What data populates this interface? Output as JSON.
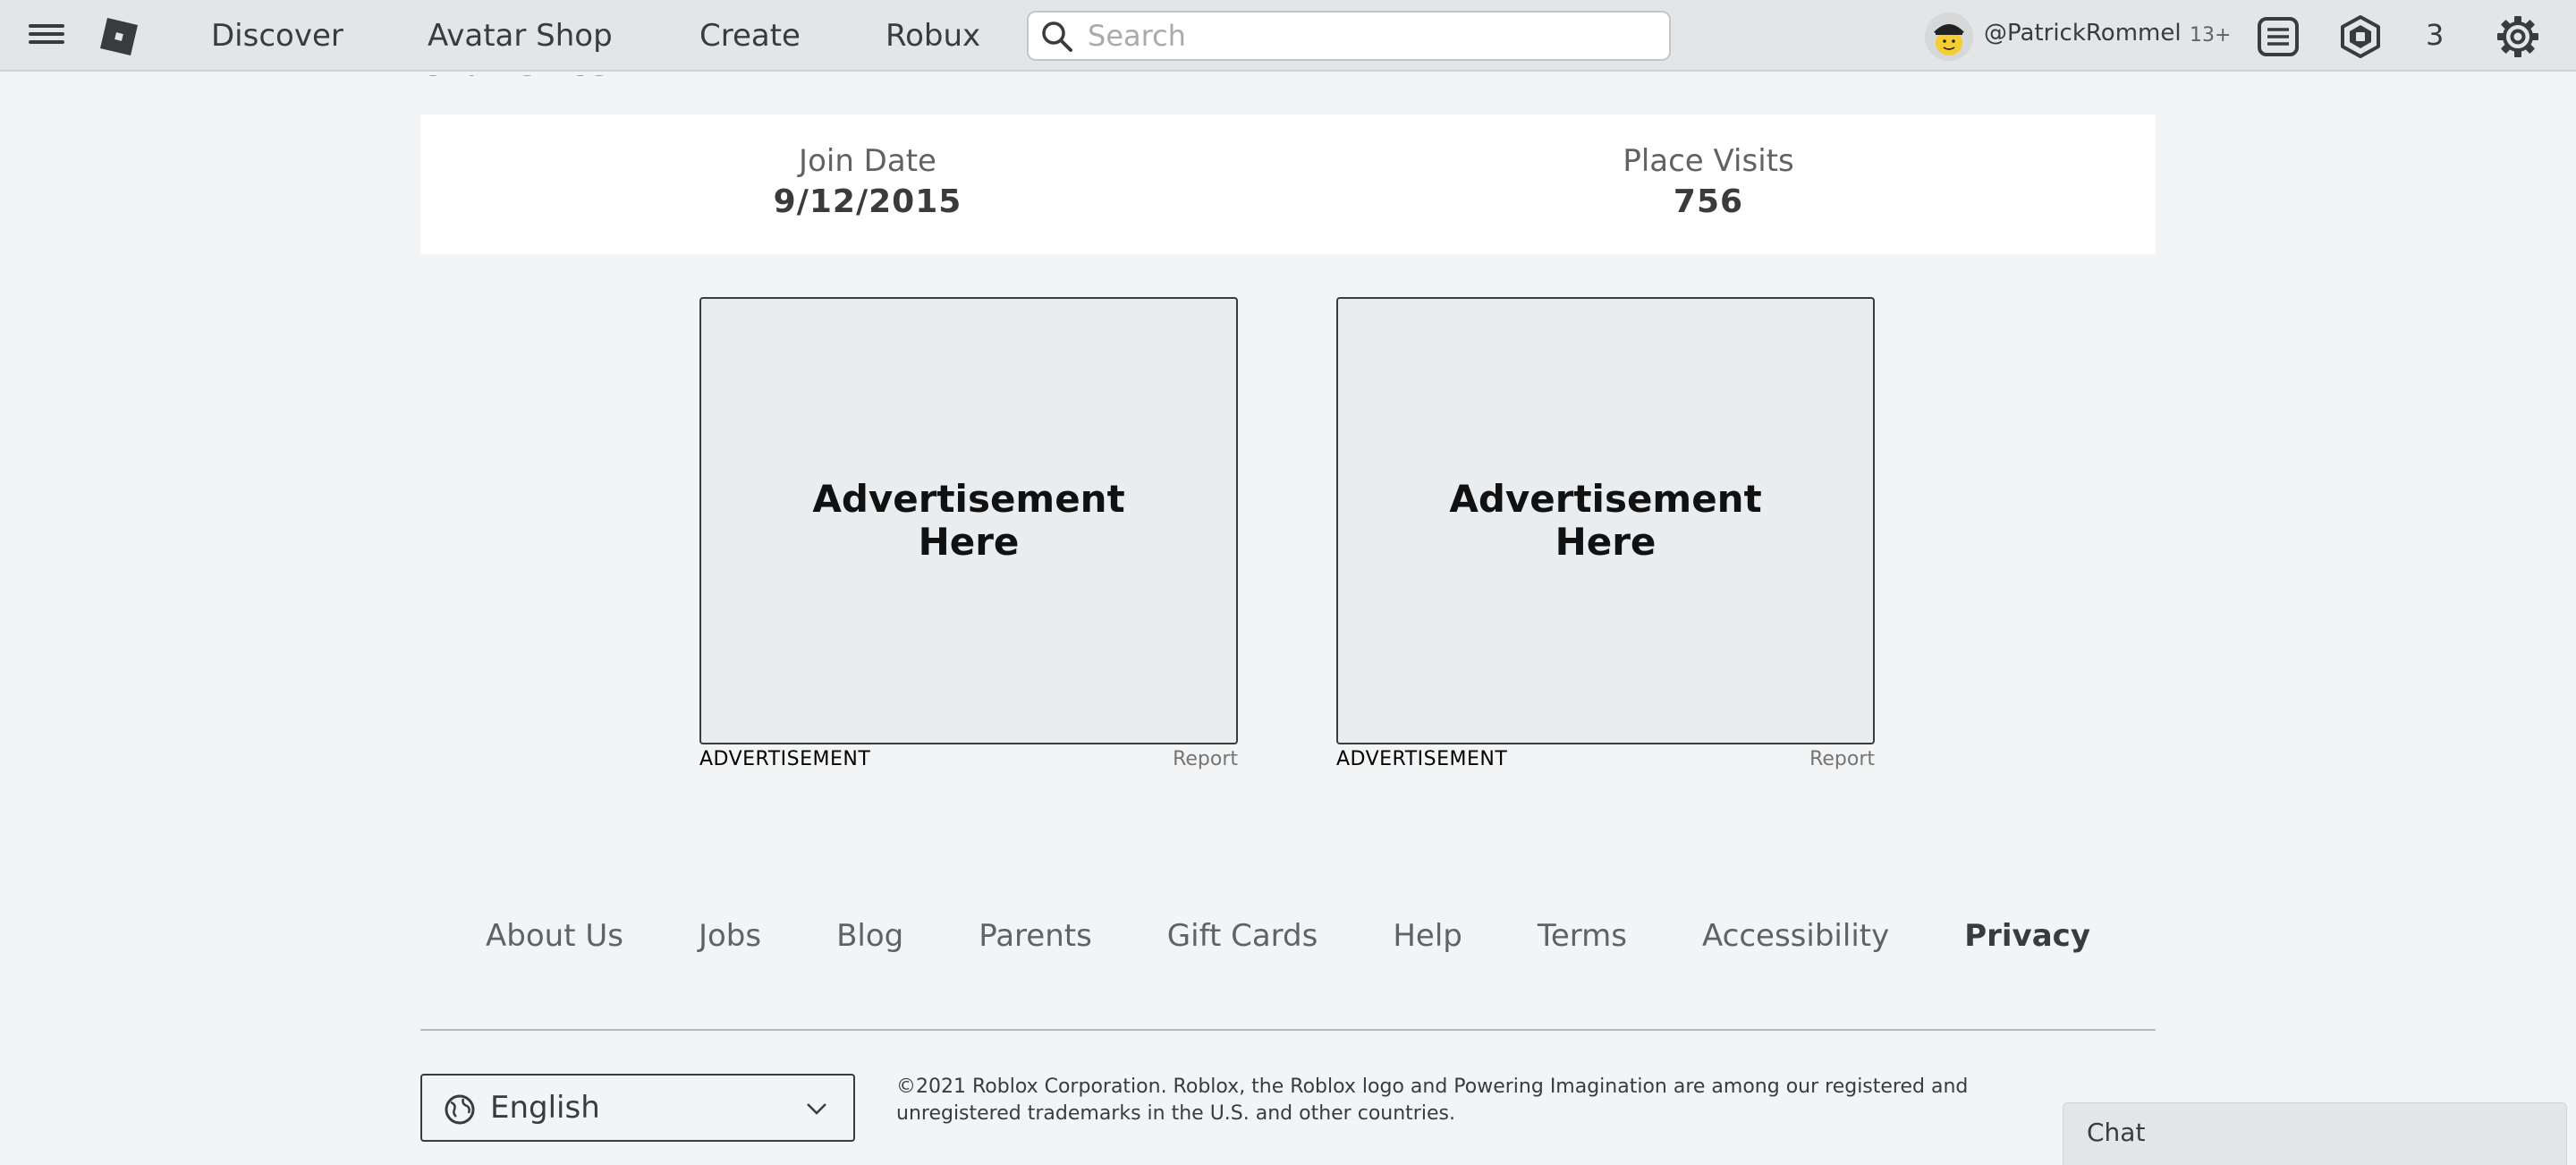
{
  "header": {
    "menu_icon": "hamburger-menu-icon",
    "logo_icon": "roblox-logo-icon",
    "nav": [
      "Discover",
      "Avatar Shop",
      "Create",
      "Robux"
    ],
    "search_placeholder": "Search",
    "username": "@PatrickRommel",
    "age_badge": "13+",
    "robux_count": "3",
    "icons": [
      "notifications-list-icon",
      "robux-icon",
      "gear-icon"
    ]
  },
  "statistics": {
    "title": "Statistics",
    "join_date_label": "Join Date",
    "join_date_value": "9/12/2015",
    "place_visits_label": "Place Visits",
    "place_visits_value": "756"
  },
  "ads": [
    {
      "text": "Advertisement\nHere",
      "label": "ADVERTISEMENT",
      "report": "Report"
    },
    {
      "text": "Advertisement\nHere",
      "label": "ADVERTISEMENT",
      "report": "Report"
    }
  ],
  "footer": {
    "links": [
      "About Us",
      "Jobs",
      "Blog",
      "Parents",
      "Gift Cards",
      "Help",
      "Terms",
      "Accessibility",
      "Privacy"
    ],
    "language": "English",
    "copyright": "©2021 Roblox Corporation. Roblox, the Roblox logo and Powering Imagination are among our registered and unregistered trademarks in the U.S. and other countries."
  },
  "chat": {
    "label": "Chat"
  },
  "colors": {
    "topbar": "#e3e5e7",
    "page": "#f2f4f5",
    "text": "#393b3d"
  }
}
